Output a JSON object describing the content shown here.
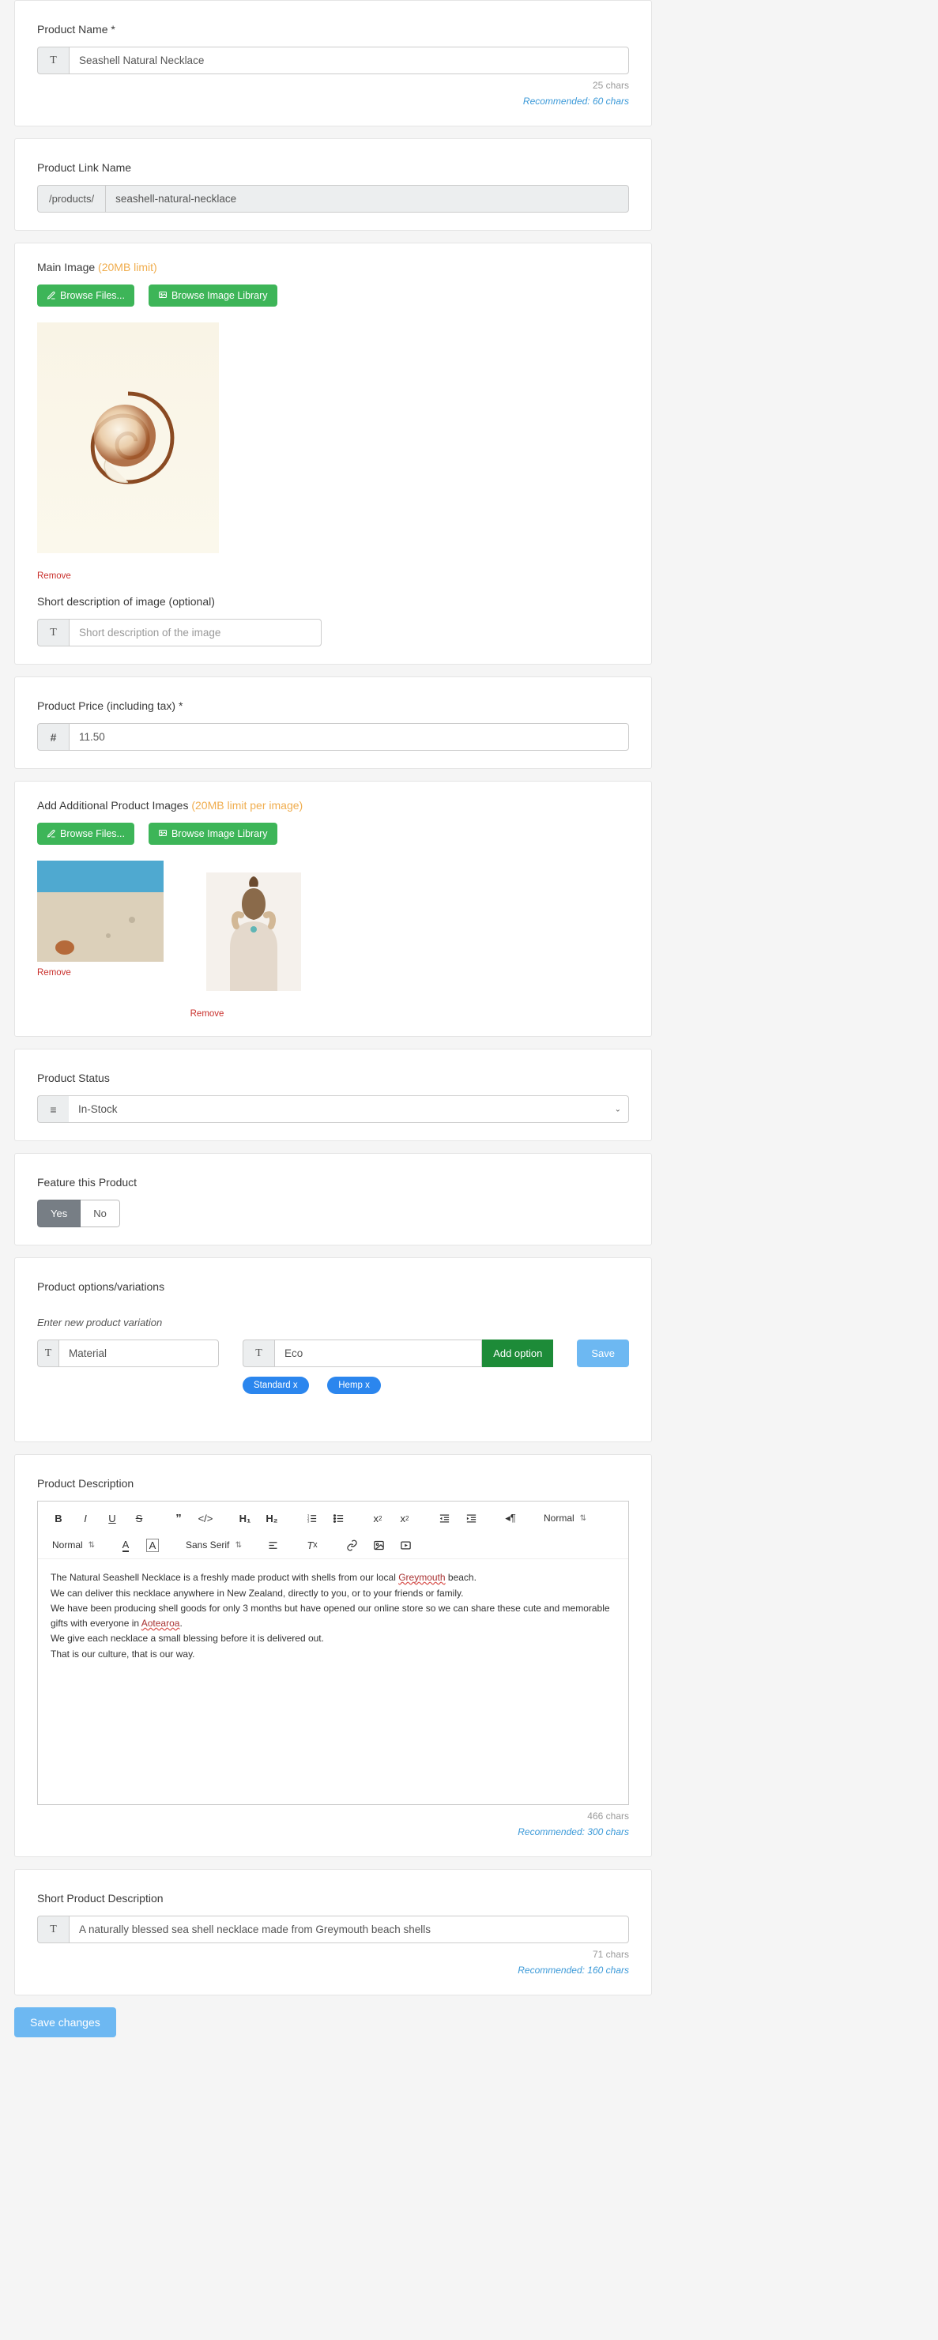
{
  "name": {
    "label": "Product Name *",
    "value": "Seashell Natural Necklace",
    "chars": "25 chars",
    "rec": "Recommended: 60 chars"
  },
  "link": {
    "label": "Product Link Name",
    "prefix": "/products/",
    "value": "seashell-natural-necklace"
  },
  "mainImage": {
    "label": "Main Image",
    "limit": "(20MB limit)",
    "browseFiles": "Browse Files...",
    "browseLibrary": "Browse Image Library",
    "remove": "Remove",
    "shortLabel": "Short description of image (optional)",
    "shortPlaceholder": "Short description of the image"
  },
  "price": {
    "label": "Product Price (including tax) *",
    "value": "11.50"
  },
  "additional": {
    "label": "Add Additional Product Images",
    "limit": "(20MB limit per image)",
    "browseFiles": "Browse Files...",
    "browseLibrary": "Browse Image Library",
    "remove1": "Remove",
    "remove2": "Remove"
  },
  "status": {
    "label": "Product Status",
    "value": "In-Stock"
  },
  "feature": {
    "label": "Feature this Product",
    "yes": "Yes",
    "no": "No"
  },
  "variations": {
    "label": "Product options/variations",
    "instr": "Enter new product variation",
    "name": "Material",
    "value": "Eco",
    "addOption": "Add option",
    "save": "Save",
    "pills": [
      "Standard x",
      "Hemp x"
    ]
  },
  "desc": {
    "label": "Product Description",
    "toolbar": {
      "normal": "Normal",
      "sansSerif": "Sans Serif"
    },
    "body": {
      "l1a": "The Natural Seashell Necklace is a freshly made product with shells from our local ",
      "g": "Greymouth",
      "l1b": " beach.",
      "l2": "We can deliver this necklace anywhere in New Zealand, directly to you, or to your friends or family.",
      "l3a": "We have been producing shell goods for only 3 months but have opened our online store so we can share these cute and memorable gifts with everyone in ",
      "a": "Aotearoa",
      "l3b": ".",
      "l4": "We give each necklace a small blessing before it is delivered out.",
      "l5": "That is our culture, that is our way."
    },
    "chars": "466 chars",
    "rec": "Recommended: 300 chars"
  },
  "shortDesc": {
    "label": "Short Product Description",
    "value": "A naturally blessed sea shell necklace made from Greymouth beach shells",
    "chars": "71 chars",
    "rec": "Recommended: 160 chars"
  },
  "saveChanges": "Save changes"
}
